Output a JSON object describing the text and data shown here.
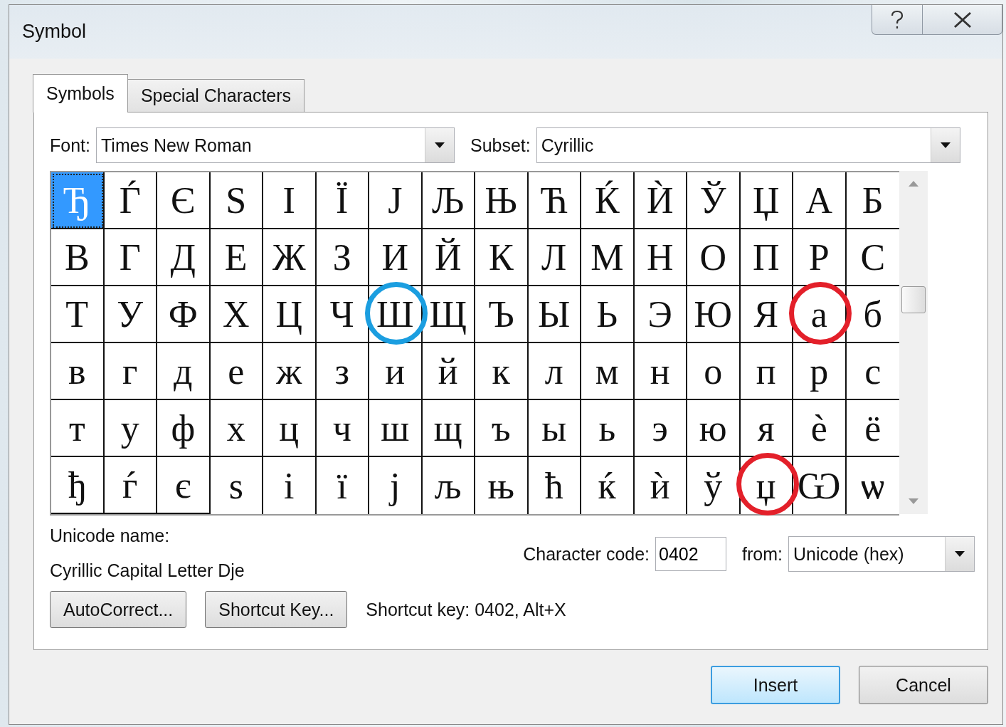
{
  "window": {
    "title": "Symbol"
  },
  "tabs": [
    {
      "label": "Symbols",
      "selected": true
    },
    {
      "label": "Special Characters",
      "selected": false
    }
  ],
  "font": {
    "label": "Font:",
    "value": "Times New Roman"
  },
  "subset": {
    "label": "Subset:",
    "value": "Cyrillic"
  },
  "grid": [
    [
      {
        "char": "Ђ",
        "selected": true
      },
      {
        "char": "Ѓ",
        "selected": false
      },
      {
        "char": "Є",
        "selected": false
      },
      {
        "char": "Ѕ",
        "selected": false
      },
      {
        "char": "І",
        "selected": false
      },
      {
        "char": "Ї",
        "selected": false
      },
      {
        "char": "Ј",
        "selected": false
      },
      {
        "char": "Љ",
        "selected": false
      },
      {
        "char": "Њ",
        "selected": false
      },
      {
        "char": "Ћ",
        "selected": false
      },
      {
        "char": "Ќ",
        "selected": false
      },
      {
        "char": "Ѝ",
        "selected": false
      },
      {
        "char": "Ў",
        "selected": false
      },
      {
        "char": "Џ",
        "selected": false
      },
      {
        "char": "А",
        "selected": false
      },
      {
        "char": "Б",
        "selected": false
      }
    ],
    [
      {
        "char": "В",
        "selected": false
      },
      {
        "char": "Г",
        "selected": false
      },
      {
        "char": "Д",
        "selected": false
      },
      {
        "char": "Е",
        "selected": false
      },
      {
        "char": "Ж",
        "selected": false
      },
      {
        "char": "З",
        "selected": false
      },
      {
        "char": "И",
        "selected": false
      },
      {
        "char": "Й",
        "selected": false
      },
      {
        "char": "К",
        "selected": false
      },
      {
        "char": "Л",
        "selected": false
      },
      {
        "char": "М",
        "selected": false
      },
      {
        "char": "Н",
        "selected": false
      },
      {
        "char": "О",
        "selected": false
      },
      {
        "char": "П",
        "selected": false
      },
      {
        "char": "Р",
        "selected": false
      },
      {
        "char": "С",
        "selected": false
      }
    ],
    [
      {
        "char": "Т",
        "selected": false
      },
      {
        "char": "У",
        "selected": false
      },
      {
        "char": "Ф",
        "selected": false
      },
      {
        "char": "Х",
        "selected": false
      },
      {
        "char": "Ц",
        "selected": false
      },
      {
        "char": "Ч",
        "selected": false
      },
      {
        "char": "Ш",
        "selected": false,
        "color": "#1b9ee0"
      },
      {
        "char": "Щ",
        "selected": false
      },
      {
        "char": "Ъ",
        "selected": false
      },
      {
        "char": "Ы",
        "selected": false
      },
      {
        "char": "Ь",
        "selected": false
      },
      {
        "char": "Э",
        "selected": false
      },
      {
        "char": "Ю",
        "selected": false
      },
      {
        "char": "Я",
        "selected": false
      },
      {
        "char": "а",
        "selected": false,
        "color": "#e3202a"
      },
      {
        "char": "б",
        "selected": false
      }
    ],
    [
      {
        "char": "в",
        "selected": false
      },
      {
        "char": "г",
        "selected": false
      },
      {
        "char": "д",
        "selected": false
      },
      {
        "char": "е",
        "selected": false
      },
      {
        "char": "ж",
        "selected": false
      },
      {
        "char": "з",
        "selected": false
      },
      {
        "char": "и",
        "selected": false
      },
      {
        "char": "й",
        "selected": false
      },
      {
        "char": "к",
        "selected": false
      },
      {
        "char": "л",
        "selected": false
      },
      {
        "char": "м",
        "selected": false
      },
      {
        "char": "н",
        "selected": false
      },
      {
        "char": "о",
        "selected": false
      },
      {
        "char": "п",
        "selected": false
      },
      {
        "char": "р",
        "selected": false
      },
      {
        "char": "с",
        "selected": false
      }
    ],
    [
      {
        "char": "т",
        "selected": false
      },
      {
        "char": "у",
        "selected": false
      },
      {
        "char": "ф",
        "selected": false
      },
      {
        "char": "х",
        "selected": false
      },
      {
        "char": "ц",
        "selected": false
      },
      {
        "char": "ч",
        "selected": false
      },
      {
        "char": "ш",
        "selected": false
      },
      {
        "char": "щ",
        "selected": false
      },
      {
        "char": "ъ",
        "selected": false
      },
      {
        "char": "ы",
        "selected": false
      },
      {
        "char": "ь",
        "selected": false
      },
      {
        "char": "э",
        "selected": false
      },
      {
        "char": "ю",
        "selected": false
      },
      {
        "char": "я",
        "selected": false
      },
      {
        "char": "ѐ",
        "selected": false
      },
      {
        "char": "ё",
        "selected": false
      }
    ],
    [
      {
        "char": "ђ",
        "selected": false
      },
      {
        "char": "ѓ",
        "selected": false
      },
      {
        "char": "є",
        "selected": false
      },
      {
        "char": "ѕ",
        "selected": false
      },
      {
        "char": "і",
        "selected": false
      },
      {
        "char": "ї",
        "selected": false
      },
      {
        "char": "ј",
        "selected": false
      },
      {
        "char": "љ",
        "selected": false
      },
      {
        "char": "њ",
        "selected": false
      },
      {
        "char": "ћ",
        "selected": false
      },
      {
        "char": "ќ",
        "selected": false
      },
      {
        "char": "ѝ",
        "selected": false
      },
      {
        "char": "ў",
        "selected": false
      },
      {
        "char": "џ",
        "selected": false,
        "color": "#e3202a"
      },
      {
        "char": "Ѡ",
        "selected": false
      },
      {
        "char": "ѡ",
        "selected": false
      }
    ]
  ],
  "unicode_name": {
    "label": "Unicode name:",
    "value": "Cyrillic Capital Letter Dje"
  },
  "character_code": {
    "label": "Character code:",
    "value": "0402"
  },
  "from": {
    "label": "from:",
    "value": "Unicode (hex)"
  },
  "buttons": [
    "AutoCorrect...",
    "Shortcut Key..."
  ],
  "shortcut_key": "Shortcut key: 0402, Alt+X",
  "dialog_buttons": [
    {
      "label": "Insert",
      "default": true
    },
    {
      "label": "Cancel",
      "default": false
    }
  ]
}
